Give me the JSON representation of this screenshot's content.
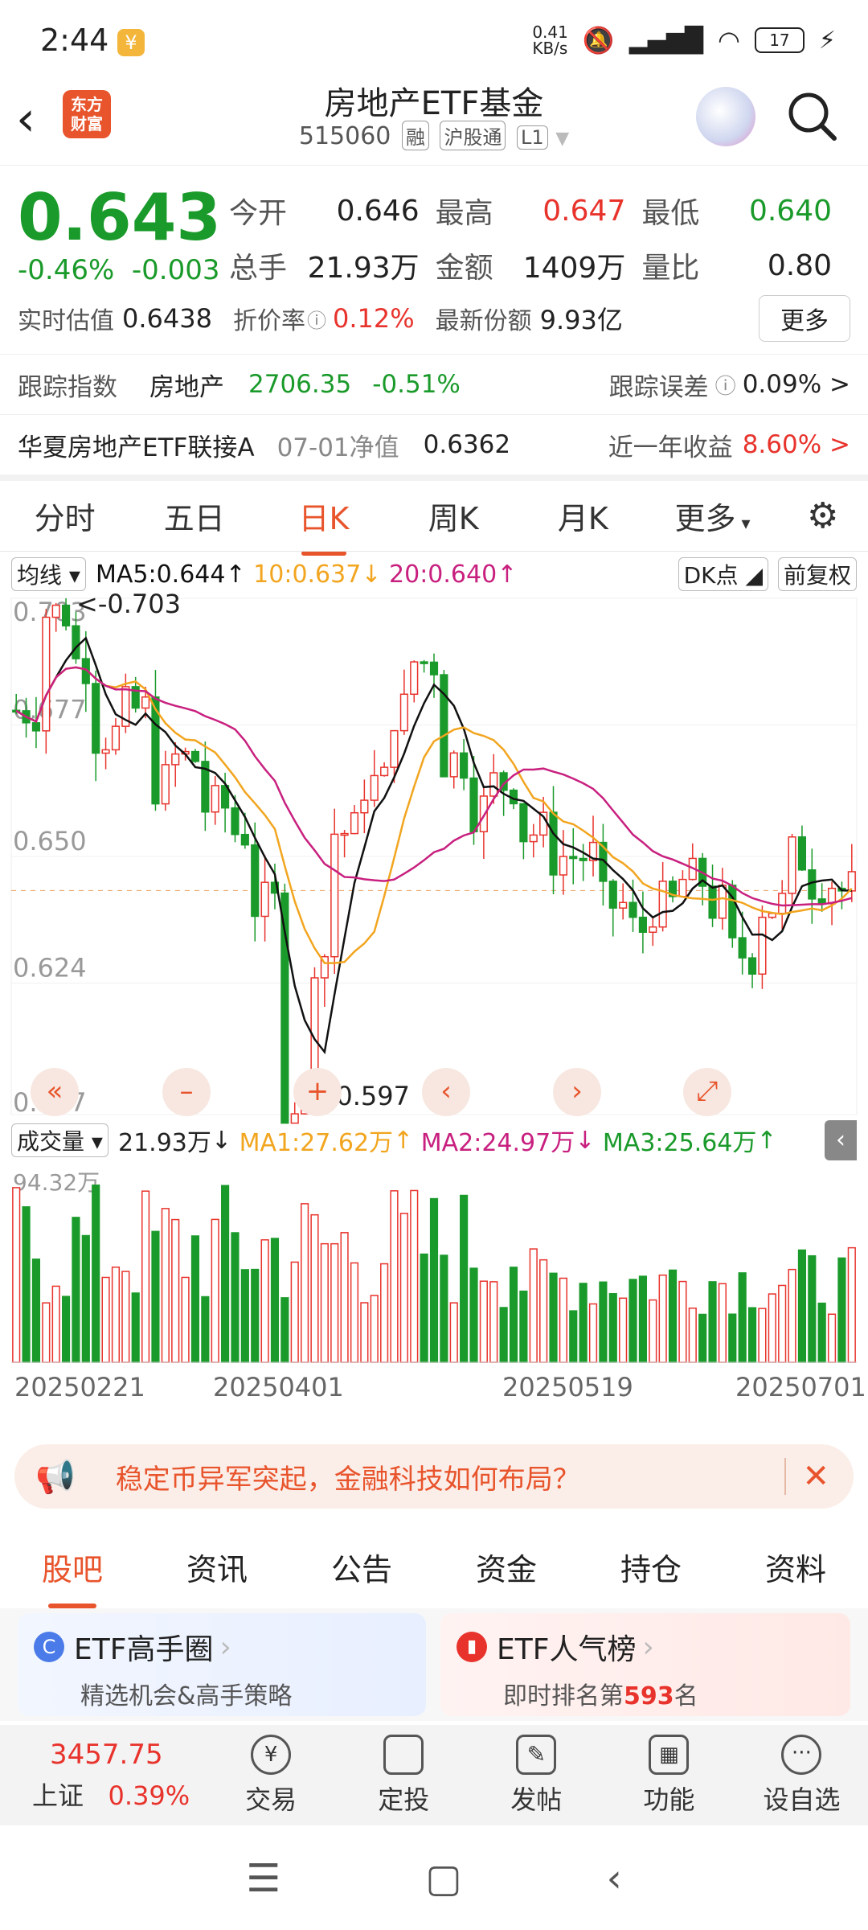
{
  "status": {
    "time": "2:44",
    "net_speed": "0.41\nKB/s",
    "battery": "17"
  },
  "header": {
    "title": "房地产ETF基金",
    "code": "515060",
    "tags": [
      "融",
      "沪股通",
      "L1"
    ],
    "logo": "东方\n财富"
  },
  "quote": {
    "price": "0.643",
    "change_pct": "-0.46%",
    "change": "-0.003",
    "open_label": "今开",
    "open": "0.646",
    "high_label": "最高",
    "high": "0.647",
    "low_label": "最低",
    "low": "0.640",
    "volume_label": "总手",
    "volume": "21.93万",
    "amount_label": "金额",
    "amount": "1409万",
    "ratio_label": "量比",
    "ratio": "0.80",
    "est_label": "实时估值",
    "est": "0.6438",
    "discount_label": "折价率",
    "discount": "0.12%",
    "share_label": "最新份额",
    "share": "9.93亿",
    "more": "更多"
  },
  "track": {
    "label": "跟踪指数",
    "index": "房地产",
    "value": "2706.35",
    "pct": "-0.51%",
    "err_label": "跟踪误差",
    "err": "0.09% >"
  },
  "link": {
    "name": "华夏房地产ETF联接A",
    "nav_label": "07-01净值",
    "nav": "0.6362",
    "ret_label": "近一年收益",
    "ret": "8.60% >"
  },
  "ktabs": [
    "分时",
    "五日",
    "日K",
    "周K",
    "月K",
    "更多"
  ],
  "ma": {
    "sel": "均线",
    "ma5": "MA5:0.644",
    "ma10": "10:0.637",
    "ma20": "20:0.640",
    "dk": "DK点",
    "fq": "前复权"
  },
  "chart_data": {
    "type": "candlestick",
    "y_ticks": [
      "0.703",
      "0.677",
      "0.650",
      "0.624",
      "0.597"
    ],
    "high_note": "<-0.703",
    "low_note": "<-0.597",
    "x_ticks": [
      "20250221",
      "20250401",
      "20250519",
      "20250701"
    ],
    "volume_max": "94.32万",
    "colors": {
      "up": "#e8332c",
      "down": "#1a9a2a",
      "ma5": "#111111",
      "ma10": "#f2a51f",
      "ma20": "#c8207f"
    }
  },
  "vol": {
    "sel": "成交量",
    "val": "21.93万",
    "ma1": "MA1:27.62万",
    "ma2": "MA2:24.97万",
    "ma3": "MA3:25.64万"
  },
  "banner": {
    "text": "稳定币异军突起，金融科技如何布局？"
  },
  "btabs": [
    "股吧",
    "资讯",
    "公告",
    "资金",
    "持仓",
    "资料"
  ],
  "cards": {
    "c1_title": "ETF高手圈",
    "c1_sub": "精选机会&高手策略",
    "c2_title": "ETF人气榜",
    "c2_sub": "即时排名第",
    "c2_rank": "593",
    "c2_suffix": "名"
  },
  "dock": {
    "index_value": "3457.75",
    "index_name": "上证",
    "index_pct": "0.39%",
    "items": [
      "交易",
      "定投",
      "发帖",
      "功能",
      "设自选"
    ]
  }
}
